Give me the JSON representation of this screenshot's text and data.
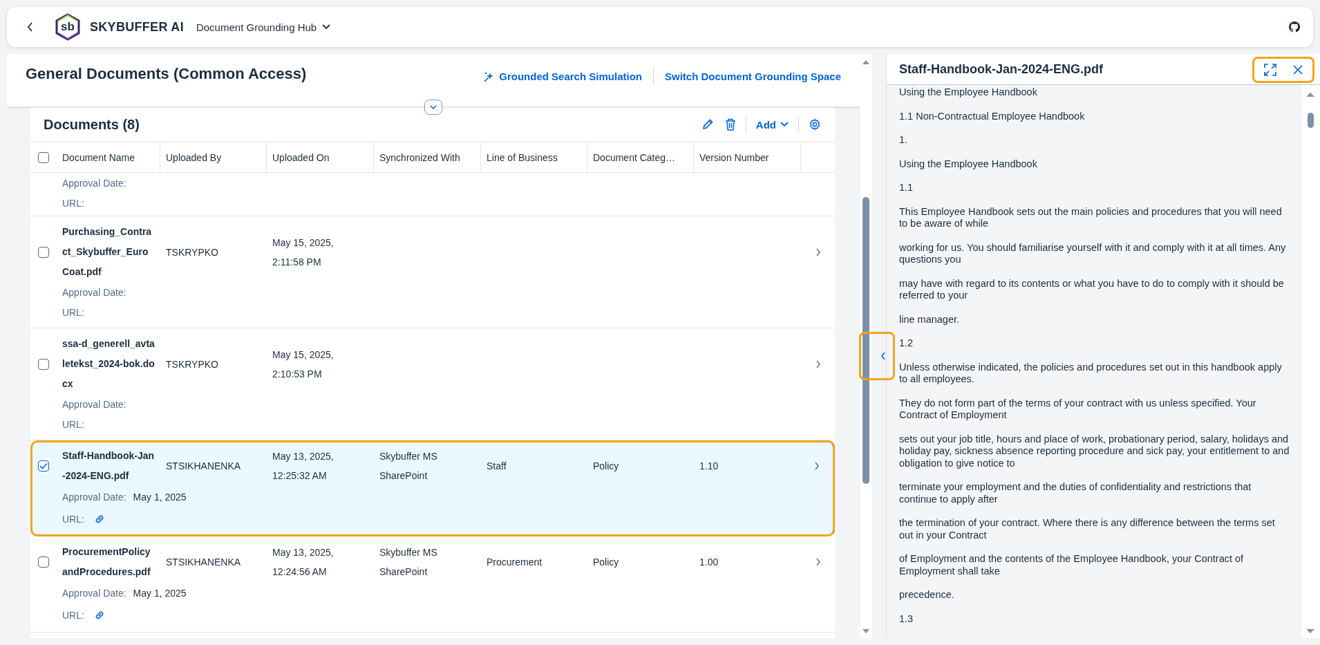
{
  "shell": {
    "logo_text": "sb",
    "brand": "SKYBUFFER AI",
    "app_title": "Document Grounding Hub"
  },
  "object_header": {
    "title": "General Documents (Common Access)",
    "actions": [
      {
        "label": "Grounded Search Simulation",
        "kind": "ai"
      },
      {
        "label": "Switch Document Grounding Space",
        "kind": "plain"
      }
    ]
  },
  "documents": {
    "title": "Documents (8)",
    "add_label": "Add",
    "select_all_checked": false,
    "columns": [
      "Document Name",
      "Uploaded By",
      "Uploaded On",
      "Synchronized With",
      "Line of Business",
      "Document Categ…",
      "Version Number"
    ],
    "rows": [
      {
        "kind": "partial",
        "approval_label": "Approval Date:",
        "url_label": "URL:"
      },
      {
        "kind": "full",
        "name": "Purchasing_Contract_Skybuffer_EuroCoat.pdf",
        "uploaded_by": "TSKRYPKO",
        "uploaded_on": "May 15, 2025, 2:11:58 PM",
        "approval_label": "Approval Date:",
        "url_label": "URL:",
        "link": false,
        "checked": false,
        "selected": false
      },
      {
        "kind": "full",
        "name": "ssa-d_generell_avtaletekst_2024-bok.docx",
        "uploaded_by": "TSKRYPKO",
        "uploaded_on": "May 15, 2025, 2:10:53 PM",
        "approval_label": "Approval Date:",
        "url_label": "URL:",
        "link": false,
        "checked": false,
        "selected": false
      },
      {
        "kind": "full",
        "name": "Staff-Handbook-Jan-2024-ENG.pdf",
        "uploaded_by": "STSIKHANENKA",
        "uploaded_on": "May 13, 2025, 12:25:32 AM",
        "synchronized_with": "Skybuffer MS SharePoint",
        "line_of_business": "Staff",
        "document_category": "Policy",
        "version_number": "1.10",
        "approval_label": "Approval Date:",
        "approval_date": "May 1, 2025",
        "url_label": "URL:",
        "link": true,
        "checked": true,
        "selected": true
      },
      {
        "kind": "full",
        "name": "ProcurementPolicyandProcedures.pdf",
        "uploaded_by": "STSIKHANENKA",
        "uploaded_on": "May 13, 2025, 12:24:56 AM",
        "synchronized_with": "Skybuffer MS SharePoint",
        "line_of_business": "Procurement",
        "document_category": "Policy",
        "version_number": "1.00",
        "approval_label": "Approval Date:",
        "approval_date": "May 1, 2025",
        "url_label": "URL:",
        "link": true,
        "checked": false,
        "selected": false
      }
    ]
  },
  "viewer": {
    "title": "Staff-Handbook-Jan-2024-ENG.pdf",
    "paragraphs": [
      "Using the Employee Handbook",
      "1.1 Non-Contractual Employee Handbook",
      "1.",
      "Using the Employee Handbook",
      "1.1",
      "This Employee Handbook sets out the main policies and procedures that you will need to be aware of while",
      "working for us. You should familiarise yourself with it and comply with it at all times. Any questions you",
      "may have with regard to its contents or what you have to do to comply with it should be referred to your",
      "line manager.",
      "1.2",
      "Unless otherwise indicated, the policies and procedures set out in this handbook apply to all employees.",
      "They do not form part of the terms of your contract with us unless specified. Your Contract of Employment",
      "sets out your job title, hours and place of work, probationary period, salary, holidays and holiday pay, sickness absence reporting procedure and sick pay, your entitlement to and obligation to give notice to",
      "terminate your employment and the duties of confidentiality and restrictions that continue to apply after",
      "the termination of your contract. Where there is any difference between the terms set out in your Contract",
      "of Employment and the contents of the Employee Handbook, your Contract of Employment shall take",
      "precedence.",
      "1.3"
    ]
  }
}
